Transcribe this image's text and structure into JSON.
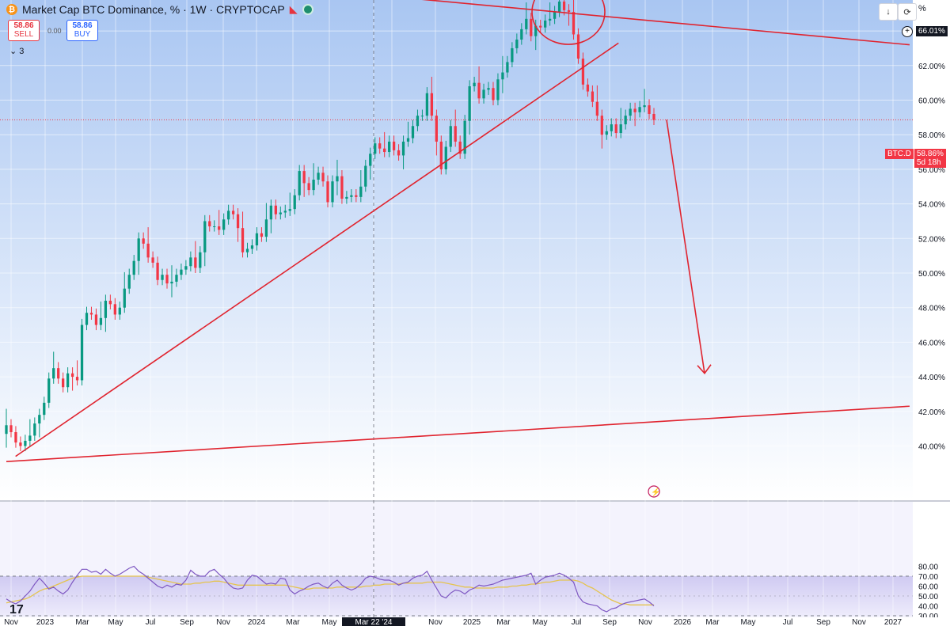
{
  "header": {
    "title": "Market Cap BTC Dominance, % · 1W · CRYPTOCAP",
    "coin_icon": "bitcoin-icon",
    "sell_price": "58.86",
    "sell_label": "SELL",
    "buy_price": "58.86",
    "buy_label": "BUY",
    "spread": "0.00",
    "indicators_count": "3",
    "pct_label": "%"
  },
  "price_tags": {
    "top": "66.01%",
    "symbol": "BTC.D",
    "current": "58.86%",
    "countdown": "5d 18h"
  },
  "colors": {
    "up": "#089981",
    "down": "#f23645",
    "annotation": "#e0242f",
    "rsi": "#7e57c2",
    "rsi_ma": "#e5c44e"
  },
  "chart_data": [
    {
      "type": "candlestick",
      "title": "Market Cap BTC Dominance, %",
      "ylim": [
        39,
        67
      ],
      "y_ticks": [
        "40.00%",
        "42.00%",
        "44.00%",
        "46.00%",
        "48.00%",
        "50.00%",
        "52.00%",
        "54.00%",
        "56.00%",
        "58.00%",
        "60.00%",
        "62.00%",
        "64.00%"
      ],
      "x_ticks": [
        "Nov",
        "2023",
        "Mar",
        "May",
        "Jul",
        "Sep",
        "Nov",
        "2024",
        "Mar",
        "May",
        "Mar 22 '24",
        "Jul",
        "Nov",
        "2025",
        "Mar",
        "May",
        "Jul",
        "Sep",
        "Nov",
        "2026",
        "Mar",
        "May",
        "Jul",
        "Sep",
        "Nov",
        "2027"
      ],
      "crosshair_label": "Mar 22 '24",
      "close_values": [
        41.2,
        40.8,
        40.2,
        40.0,
        40.3,
        40.6,
        41.3,
        41.8,
        42.5,
        43.9,
        44.5,
        43.9,
        43.4,
        44.2,
        44.0,
        43.8,
        47.0,
        47.7,
        47.6,
        47.0,
        47.4,
        48.4,
        48.2,
        47.6,
        48.0,
        49.1,
        49.9,
        50.7,
        52.0,
        51.7,
        50.9,
        50.6,
        49.6,
        49.9,
        49.4,
        49.5,
        49.9,
        50.2,
        50.4,
        50.9,
        50.3,
        51.2,
        53.0,
        52.7,
        52.7,
        52.5,
        53.1,
        53.6,
        53.4,
        52.6,
        51.2,
        51.4,
        51.6,
        52.3,
        52.1,
        53.1,
        53.9,
        53.4,
        53.5,
        53.6,
        53.7,
        54.5,
        55.9,
        55.2,
        54.8,
        55.4,
        55.8,
        55.3,
        54.1,
        55.3,
        55.6,
        54.3,
        54.4,
        54.5,
        54.4,
        55.0,
        56.2,
        56.9,
        57.5,
        57.2,
        57.0,
        57.6,
        57.1,
        56.8,
        57.6,
        57.8,
        58.5,
        59.1,
        59.1,
        60.4,
        59.1,
        57.6,
        56.0,
        57.3,
        58.5,
        57.6,
        56.9,
        58.8,
        60.8,
        61.0,
        60.1,
        60.6,
        60.7,
        60.0,
        61.2,
        61.6,
        62.2,
        63.0,
        63.5,
        64.1,
        64.7,
        63.7,
        64.3,
        64.2,
        64.6,
        64.7,
        65.1,
        65.7,
        65.2,
        65.1,
        63.8,
        62.4,
        60.9,
        60.5,
        59.9,
        59.1,
        58.0,
        58.2,
        58.6,
        58.1,
        58.6,
        59.1,
        59.5,
        59.3,
        59.6,
        59.7,
        59.2,
        58.86
      ],
      "annotations": {
        "descending_resistance": [
          [
            2022.96,
            67.9
          ],
          [
            2026.74,
            63.2
          ]
        ],
        "rising_support": [
          [
            2022.87,
            39.4
          ],
          [
            2025.48,
            63.3
          ]
        ],
        "long_base_line": [
          [
            2022.83,
            39.1
          ],
          [
            2026.74,
            42.3
          ]
        ],
        "projection_arrow_to": 44.2,
        "top_circle_center": 65.1
      }
    },
    {
      "type": "line",
      "title": "RSI",
      "ylim": [
        30,
        82
      ],
      "y_ticks": [
        "30.00",
        "40.00",
        "50.00",
        "60.00",
        "70.00",
        "80.00"
      ],
      "bands": [
        30,
        70
      ],
      "series": [
        {
          "values": [
            47,
            44,
            42,
            45,
            50,
            55,
            62,
            68,
            63,
            57,
            59,
            55,
            52,
            56,
            64,
            71,
            77,
            77,
            74,
            75,
            72,
            77,
            73,
            70,
            72,
            75,
            78,
            80,
            75,
            72,
            68,
            64,
            60,
            58,
            61,
            59,
            62,
            61,
            66,
            76,
            72,
            70,
            70,
            75,
            77,
            72,
            68,
            62,
            58,
            57,
            58,
            66,
            71,
            70,
            66,
            62,
            63,
            62,
            68,
            67,
            56,
            52,
            55,
            57,
            60,
            62,
            63,
            60,
            58,
            63,
            66,
            61,
            58,
            56,
            58,
            62,
            68,
            70,
            69,
            67,
            66,
            66,
            64,
            61,
            63,
            64,
            68,
            70,
            71,
            75,
            66,
            58,
            50,
            48,
            53,
            56,
            55,
            52,
            56,
            58,
            61,
            60,
            61,
            62,
            64,
            66,
            67,
            68,
            69,
            70,
            71,
            73,
            62,
            66,
            69,
            70,
            71,
            73,
            71,
            68,
            64,
            50,
            44,
            42,
            41,
            40,
            36,
            34,
            37,
            38,
            41,
            43,
            44,
            45,
            46,
            47,
            44,
            40
          ]
        },
        {
          "values": [
            43,
            44,
            45,
            46,
            47,
            49,
            52,
            55,
            57,
            58,
            60,
            62,
            64,
            66,
            68,
            69,
            70,
            70,
            70,
            70,
            70,
            70,
            70,
            70,
            70,
            70,
            70,
            70,
            70,
            70,
            69,
            68,
            67,
            66,
            65,
            64,
            63,
            62,
            62,
            62,
            63,
            63,
            64,
            64,
            65,
            65,
            64,
            63,
            62,
            61,
            61,
            61,
            61,
            61,
            61,
            61,
            61,
            61,
            61,
            61,
            60,
            59,
            58,
            57,
            57,
            58,
            58,
            58,
            58,
            58,
            59,
            59,
            59,
            59,
            59,
            59,
            60,
            60,
            61,
            61,
            62,
            62,
            62,
            62,
            63,
            63,
            63,
            63,
            63,
            64,
            64,
            64,
            64,
            63,
            62,
            61,
            60,
            59,
            59,
            58,
            58,
            58,
            58,
            58,
            59,
            59,
            59,
            60,
            60,
            61,
            61,
            62,
            62,
            63,
            64,
            64,
            65,
            66,
            66,
            66,
            66,
            65,
            63,
            60,
            58,
            55,
            52,
            49,
            46,
            44,
            42,
            42,
            41,
            41,
            41,
            41,
            41,
            41
          ]
        }
      ]
    }
  ]
}
